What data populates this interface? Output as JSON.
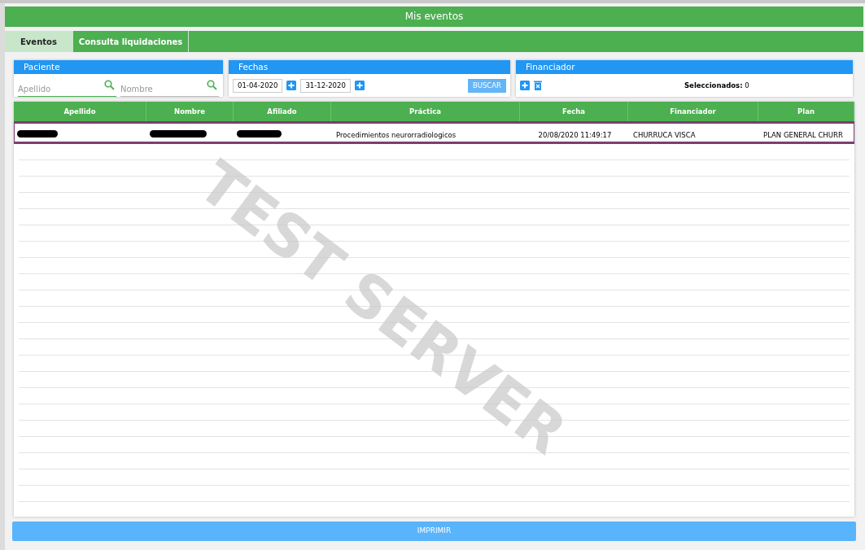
{
  "title": "Mis eventos",
  "tabs": [
    {
      "label": "Eventos",
      "selected": true
    },
    {
      "label": "Consulta liquidaciones",
      "selected": false
    }
  ],
  "paciente": {
    "title": "Paciente",
    "fields": [
      {
        "placeholder": "Apellido",
        "focused": true
      },
      {
        "placeholder": "Nombre",
        "focused": false
      }
    ]
  },
  "fechas": {
    "title": "Fechas",
    "from": "01-04-2020",
    "to": "31-12-2020",
    "search_button": "BUSCAR"
  },
  "financiador": {
    "title": "Financiador",
    "selected_label": "Seleccionados:",
    "selected_count": "0"
  },
  "table": {
    "columns": [
      "Apellido",
      "Nombre",
      "Afiliado",
      "Práctica",
      "Fecha",
      "Financiador",
      "Plan"
    ],
    "rows": [
      {
        "selected": true,
        "cells": [
          {
            "kind": "redacted"
          },
          {
            "kind": "redacted"
          },
          {
            "kind": "redacted"
          },
          {
            "kind": "text",
            "text": "Procedimientos neurorradiologicos"
          },
          {
            "kind": "datetime",
            "text": "20/08/2020 11:49:17"
          },
          {
            "kind": "text",
            "text": "CHURRUCA VISCA"
          },
          {
            "kind": "text",
            "text": "PLAN GENERAL CHURR"
          }
        ]
      }
    ]
  },
  "watermark": "TEST SERVER",
  "print_button": "IMPRIMIR"
}
